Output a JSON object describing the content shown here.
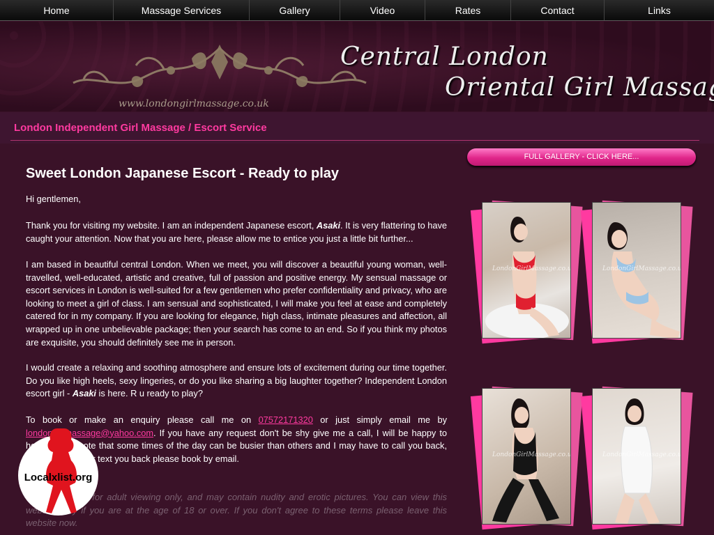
{
  "nav": {
    "items": [
      "Home",
      "Massage Services",
      "Gallery",
      "Video",
      "Rates",
      "Contact",
      "Links"
    ]
  },
  "banner": {
    "title_line1": "Central London",
    "title_line2": "Oriental Girl Massage",
    "url": "www.londongirlmassage.co.uk"
  },
  "subheader": {
    "title": "London Independent Girl Massage / Escort Service"
  },
  "main": {
    "heading": "Sweet London Japanese Escort - Ready to play",
    "greeting": "Hi gentlemen,",
    "p1_a": "Thank you for visiting my website. I am an independent Japanese escort, ",
    "p1_name": "Asaki",
    "p1_b": ". It is very flattering to have caught your attention. Now that you are here, please allow me to entice you just a little bit further...",
    "p2": "I am based in beautiful central London. When we meet, you will discover a beautiful young woman, well-travelled, well-educated, artistic and creative, full of passion and positive energy. My sensual massage or escort services in London is well-suited for a few gentlemen who prefer confidentiality and privacy, who are looking to meet a girl of class. I am sensual and sophisticated, I will make you feel at ease and completely catered for in my company. If you are looking for elegance, high class, intimate pleasures and affection, all wrapped up in one unbelievable package; then your search has come to an end. So if you think my photos are exquisite, you should definitely see me in person.",
    "p3_a": "I would create a relaxing and soothing atmosphere and ensure lots of excitement during our time together. Do you like high heels, sexy lingeries, or do you like sharing a big laughter together? Independent London escort girl - ",
    "p3_name": "Asaki",
    "p3_b": " is here. R u ready to play?",
    "p4_a": "To book or make an enquiry please call me on ",
    "p4_phone": "07572171320",
    "p4_b": " or just simply email me by ",
    "p4_email": "londongirlmassage@yahoo.com",
    "p4_c": ". If you have any request don't be shy give me a call, I will be happy to help. Please note that some times of the day can be busier than others and I may have to call you back, please call you or text you back please book by email.",
    "disclaimer": "This website is for adult viewing only, and may contain nudity and erotic pictures. You can view this website only if you are at the age of 18 or over. If you don't agree to these terms please leave this website now."
  },
  "sidebar": {
    "gallery_button": "FULL GALLERY - CLICK HERE...",
    "photo_watermark": "LondonGirlMassage.co.uk"
  },
  "logo": {
    "text": "Localxlist.org"
  },
  "colors": {
    "accent_pink": "#ff3aa0",
    "background": "#3a1228"
  }
}
